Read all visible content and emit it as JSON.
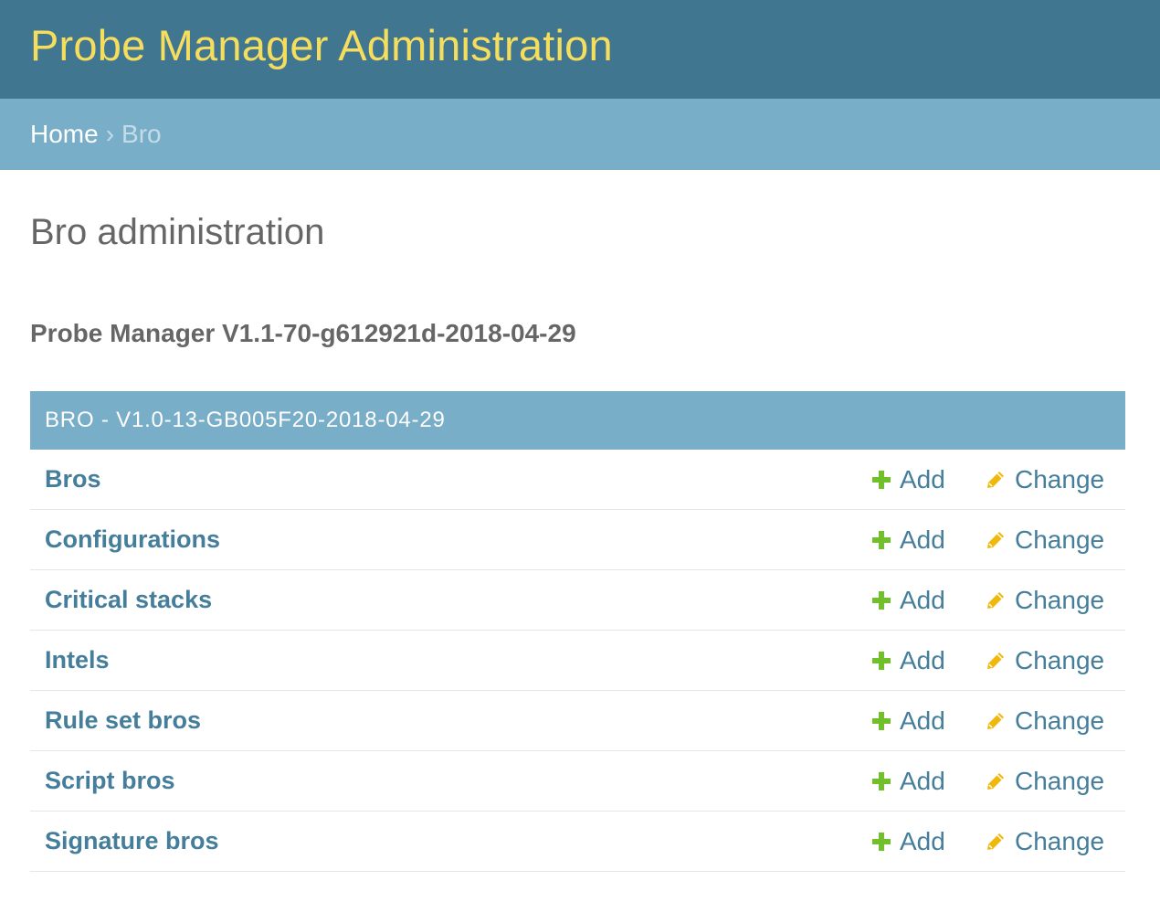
{
  "header": {
    "site_name": "Probe Manager Administration"
  },
  "breadcrumbs": {
    "home": "Home",
    "separator": "›",
    "current": "Bro"
  },
  "page": {
    "title": "Bro administration",
    "version": "Probe Manager V1.1-70-g612921d-2018-04-29"
  },
  "module": {
    "caption": "BRO - V1.0-13-GB005F20-2018-04-29",
    "add_label": "Add",
    "change_label": "Change",
    "models": [
      {
        "name": "Bros"
      },
      {
        "name": "Configurations"
      },
      {
        "name": "Critical stacks"
      },
      {
        "name": "Intels"
      },
      {
        "name": "Rule set bros"
      },
      {
        "name": "Script bros"
      },
      {
        "name": "Signature bros"
      }
    ]
  },
  "colors": {
    "header_bg": "#417690",
    "site_name": "#f5dd5d",
    "breadcrumbs_bg": "#79aec8",
    "link": "#447e9b",
    "add_icon": "#70bf2b",
    "change_icon": "#efb80b"
  },
  "icons": {
    "add": "plus-icon",
    "change": "pencil-icon"
  }
}
